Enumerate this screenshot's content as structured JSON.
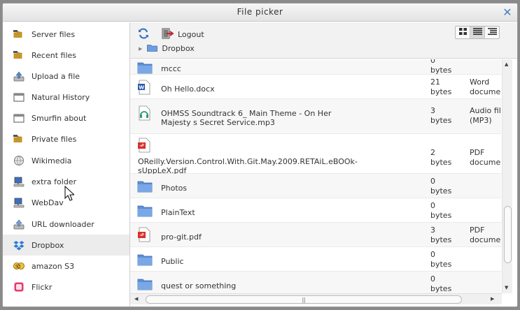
{
  "dialog": {
    "title": "File picker"
  },
  "sidebar": {
    "items": [
      {
        "label": "Server files",
        "icon": "moodle-m-icon"
      },
      {
        "label": "Recent files",
        "icon": "moodle-m-icon"
      },
      {
        "label": "Upload a file",
        "icon": "upload-icon"
      },
      {
        "label": "Natural History",
        "icon": "window-icon"
      },
      {
        "label": "Smurfin about",
        "icon": "window-icon"
      },
      {
        "label": "Private files",
        "icon": "moodle-m-icon"
      },
      {
        "label": "Wikimedia",
        "icon": "wikimedia-globe-icon"
      },
      {
        "label": "extra folder",
        "icon": "filesystem-computer-icon"
      },
      {
        "label": "WebDav",
        "icon": "filesystem-computer-icon"
      },
      {
        "label": "URL downloader",
        "icon": "url-download-icon"
      },
      {
        "label": "Dropbox",
        "icon": "dropbox-icon"
      },
      {
        "label": "amazon S3",
        "icon": "s3-icon"
      },
      {
        "label": "Flickr",
        "icon": "flickr-icon"
      }
    ],
    "active_index": 10
  },
  "toolbar": {
    "logout_label": "Logout",
    "breadcrumb": "Dropbox",
    "view_modes": [
      "icons-view",
      "list-view",
      "tree-view"
    ],
    "active_view": 1
  },
  "files": [
    {
      "name": "mccc",
      "size_value": "0",
      "size_unit": "bytes",
      "type_line1": "",
      "type_line2": "",
      "icon": "folder-icon"
    },
    {
      "name": "Oh Hello.docx",
      "size_value": "21",
      "size_unit": "bytes",
      "type_line1": "Word",
      "type_line2": "document",
      "icon": "word-doc-icon"
    },
    {
      "name_line1": "OHMSS Soundtrack 6_ Main Theme - On Her",
      "name_line2": "Majesty s Secret Service.mp3",
      "size_value": "3",
      "size_unit": "bytes",
      "type_line1": "Audio file",
      "type_line2": "(MP3)",
      "icon": "audio-file-icon"
    },
    {
      "name_line1": "OReilly.Version.Control.With.Git.May.2009.RETAiL.eBOOk-",
      "name_line2": "sUppLeX.pdf",
      "size_value": "2",
      "size_unit": "bytes",
      "type_line1": "PDF",
      "type_line2": "document",
      "icon": "pdf-icon"
    },
    {
      "name": "Photos",
      "size_value": "0",
      "size_unit": "bytes",
      "type_line1": "",
      "type_line2": "",
      "icon": "folder-icon"
    },
    {
      "name": "PlainText",
      "size_value": "0",
      "size_unit": "bytes",
      "type_line1": "",
      "type_line2": "",
      "icon": "folder-icon"
    },
    {
      "name": "pro-git.pdf",
      "size_value": "3",
      "size_unit": "bytes",
      "type_line1": "PDF",
      "type_line2": "document",
      "icon": "pdf-icon"
    },
    {
      "name": "Public",
      "size_value": "0",
      "size_unit": "bytes",
      "type_line1": "",
      "type_line2": "",
      "icon": "folder-icon"
    },
    {
      "name": "quest or something",
      "size_value": "0",
      "size_unit": "bytes",
      "type_line1": "",
      "type_line2": "",
      "icon": "folder-icon"
    }
  ],
  "colors": {
    "folder": "#5d8fd6",
    "accent": "#4a7fbf",
    "pdf": "#d9312b"
  }
}
